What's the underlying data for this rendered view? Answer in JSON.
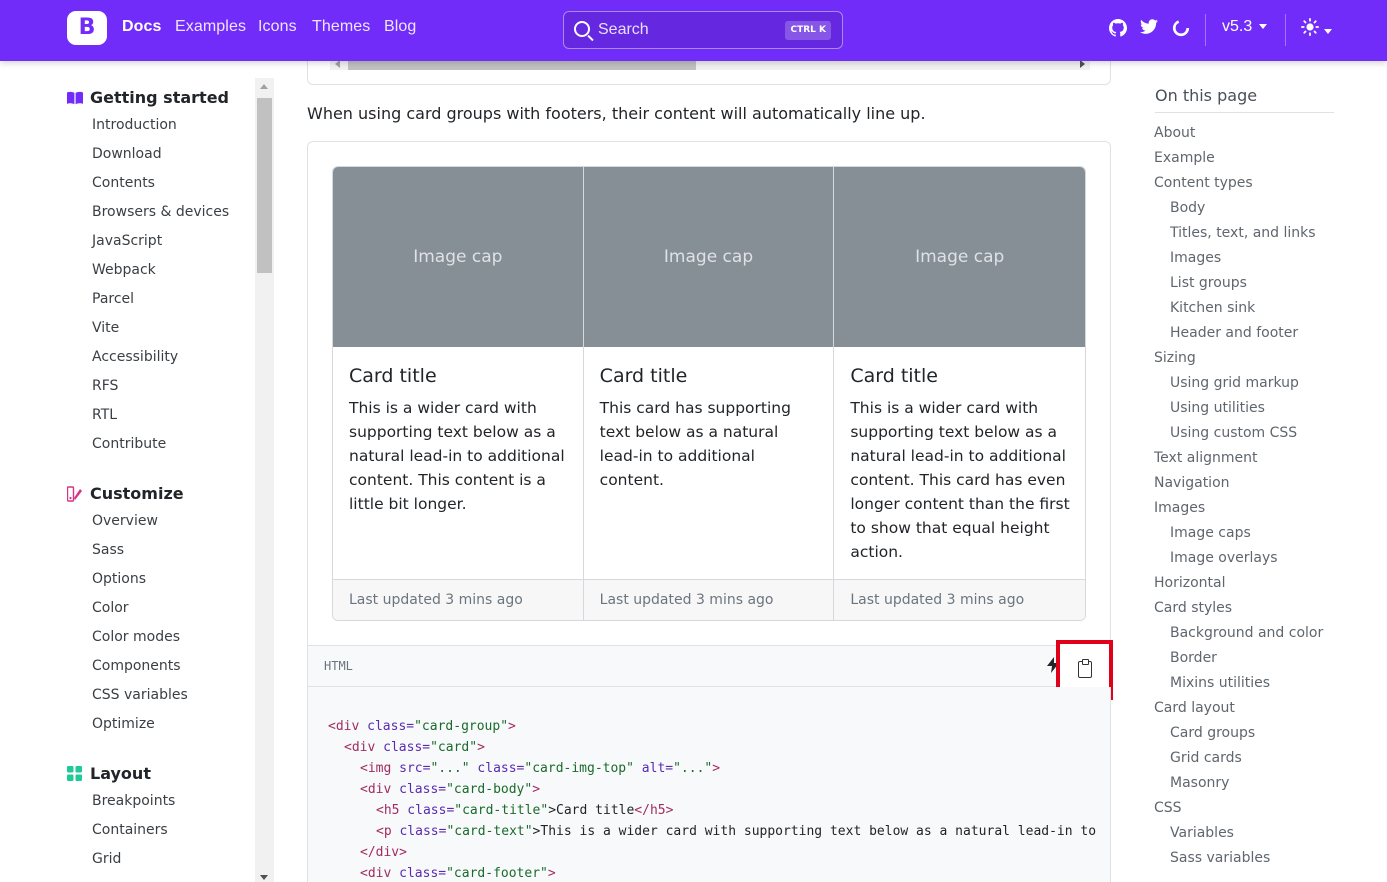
{
  "navbar": {
    "brand": "B",
    "links": [
      "Docs",
      "Examples",
      "Icons",
      "Themes",
      "Blog"
    ],
    "search_placeholder": "Search",
    "search_shortcut": "CTRL K",
    "version": "v5.3"
  },
  "sidebar": {
    "sections": [
      {
        "title": "Getting started",
        "icon_color": "#712cf9",
        "items": [
          "Introduction",
          "Download",
          "Contents",
          "Browsers & devices",
          "JavaScript",
          "Webpack",
          "Parcel",
          "Vite",
          "Accessibility",
          "RFS",
          "RTL",
          "Contribute"
        ]
      },
      {
        "title": "Customize",
        "icon_color": "#d63384",
        "items": [
          "Overview",
          "Sass",
          "Options",
          "Color",
          "Color modes",
          "Components",
          "CSS variables",
          "Optimize"
        ]
      },
      {
        "title": "Layout",
        "icon_color": "#20c997",
        "items": [
          "Breakpoints",
          "Containers",
          "Grid"
        ]
      }
    ]
  },
  "main": {
    "intro": "When using card groups with footers, their content will automatically line up.",
    "cards": [
      {
        "img": "Image cap",
        "title": "Card title",
        "text": "This is a wider card with supporting text below as a natural lead-in to additional content. This content is a little bit longer.",
        "footer": "Last updated 3 mins ago"
      },
      {
        "img": "Image cap",
        "title": "Card title",
        "text": "This card has supporting text below as a natural lead-in to additional content.",
        "footer": "Last updated 3 mins ago"
      },
      {
        "img": "Image cap",
        "title": "Card title",
        "text": "This is a wider card with supporting text below as a natural lead-in to additional content. This card has even longer content than the first to show that equal height action.",
        "footer": "Last updated 3 mins ago"
      }
    ],
    "code_label": "HTML",
    "code_lines": {
      "l1": [
        "<div",
        " class=",
        "\"card-group\"",
        ">"
      ],
      "l2": [
        "<div",
        " class=",
        "\"card\"",
        ">"
      ],
      "l3": [
        "<img",
        " src=",
        "\"...\"",
        " class=",
        "\"card-img-top\"",
        " alt=",
        "\"...\"",
        ">"
      ],
      "l4": [
        "<div",
        " class=",
        "\"card-body\"",
        ">"
      ],
      "l5": [
        "<h5",
        " class=",
        "\"card-title\"",
        ">Card title",
        "</h5>"
      ],
      "l6": [
        "<p",
        " class=",
        "\"card-text\"",
        ">This is a wider card with supporting text below as a natural lead-in to"
      ],
      "l7": [
        "</div>"
      ],
      "l8": [
        "<div",
        " class=",
        "\"card-footer\"",
        ">"
      ]
    }
  },
  "toc": {
    "title": "On this page",
    "items": [
      {
        "label": "About",
        "level": 1
      },
      {
        "label": "Example",
        "level": 1
      },
      {
        "label": "Content types",
        "level": 1
      },
      {
        "label": "Body",
        "level": 2
      },
      {
        "label": "Titles, text, and links",
        "level": 2
      },
      {
        "label": "Images",
        "level": 2
      },
      {
        "label": "List groups",
        "level": 2
      },
      {
        "label": "Kitchen sink",
        "level": 2
      },
      {
        "label": "Header and footer",
        "level": 2
      },
      {
        "label": "Sizing",
        "level": 1
      },
      {
        "label": "Using grid markup",
        "level": 2
      },
      {
        "label": "Using utilities",
        "level": 2
      },
      {
        "label": "Using custom CSS",
        "level": 2
      },
      {
        "label": "Text alignment",
        "level": 1
      },
      {
        "label": "Navigation",
        "level": 1
      },
      {
        "label": "Images",
        "level": 1
      },
      {
        "label": "Image caps",
        "level": 2
      },
      {
        "label": "Image overlays",
        "level": 2
      },
      {
        "label": "Horizontal",
        "level": 1
      },
      {
        "label": "Card styles",
        "level": 1
      },
      {
        "label": "Background and color",
        "level": 2
      },
      {
        "label": "Border",
        "level": 2
      },
      {
        "label": "Mixins utilities",
        "level": 2
      },
      {
        "label": "Card layout",
        "level": 1
      },
      {
        "label": "Card groups",
        "level": 2
      },
      {
        "label": "Grid cards",
        "level": 2
      },
      {
        "label": "Masonry",
        "level": 2
      },
      {
        "label": "CSS",
        "level": 1
      },
      {
        "label": "Variables",
        "level": 2
      },
      {
        "label": "Sass variables",
        "level": 2
      }
    ]
  }
}
